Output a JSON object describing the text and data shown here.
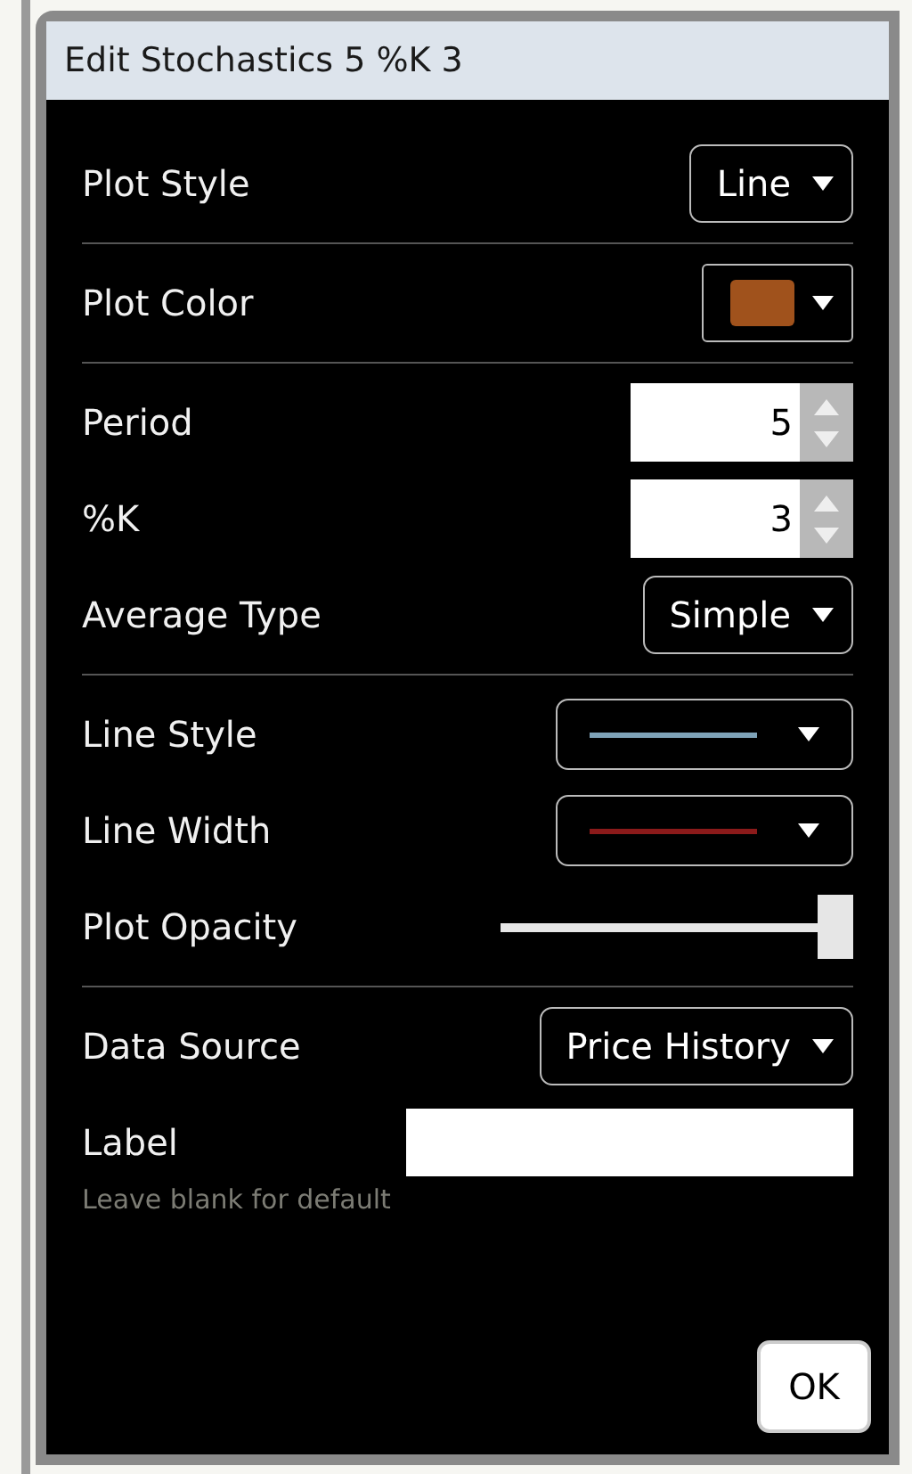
{
  "window": {
    "title": "Edit Stochastics 5 %K 3"
  },
  "sections": [
    {
      "rows": [
        {
          "kind": "dropdown",
          "label": "Plot Style",
          "value": "Line"
        }
      ]
    },
    {
      "rows": [
        {
          "kind": "color",
          "label": "Plot Color",
          "color": "#a0521c"
        }
      ]
    },
    {
      "rows": [
        {
          "kind": "spinner",
          "label": "Period",
          "value": "5"
        },
        {
          "kind": "spinner",
          "label": "%K",
          "value": "3"
        },
        {
          "kind": "dropdown",
          "label": "Average Type",
          "value": "Simple"
        }
      ]
    },
    {
      "rows": [
        {
          "kind": "line",
          "label": "Line Style",
          "color": "#7fa3b8"
        },
        {
          "kind": "line",
          "label": "Line Width",
          "color": "#8b1a1a"
        },
        {
          "kind": "slider",
          "label": "Plot Opacity",
          "level": 1
        }
      ]
    },
    {
      "rows": [
        {
          "kind": "dropdown",
          "label": "Data Source",
          "value": "Price History"
        },
        {
          "kind": "text",
          "label": "Label",
          "hint": "Leave blank for default"
        }
      ]
    }
  ],
  "buttons": [
    "OK"
  ]
}
